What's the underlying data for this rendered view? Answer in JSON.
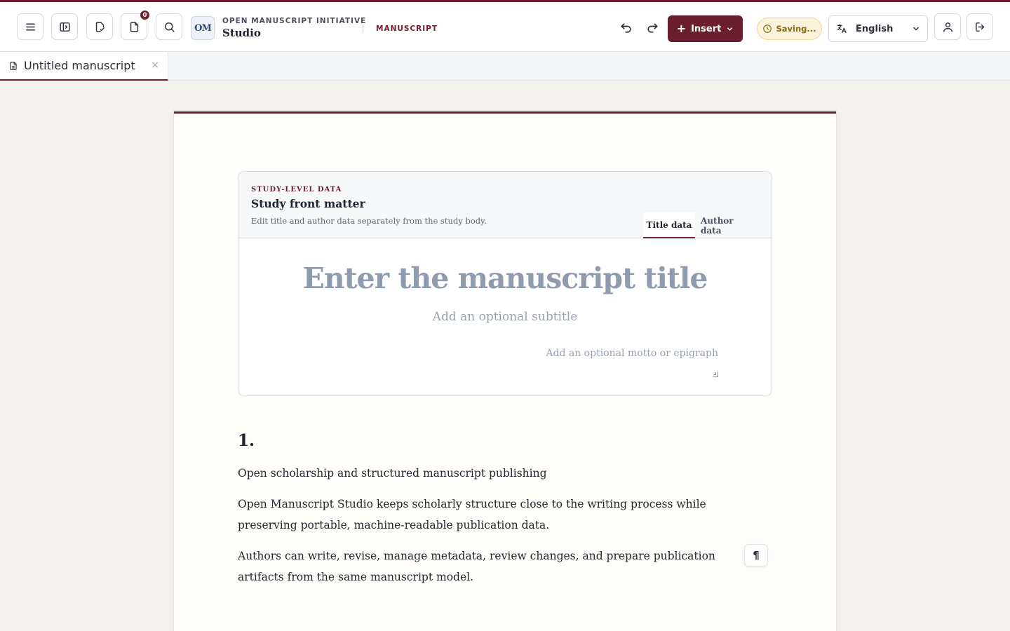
{
  "header": {
    "org_name": "OPEN MANUSCRIPT INITIATIVE",
    "app_name": "Studio",
    "logo_text": "OM",
    "mode": "MANUSCRIPT",
    "notification_count": "0",
    "insert_label": "Insert",
    "status": "Saving...",
    "language": "English"
  },
  "tabs": [
    {
      "label": "Untitled manuscript",
      "close": "×"
    }
  ],
  "front_matter": {
    "eyebrow": "STUDY-LEVEL DATA",
    "title": "Study front matter",
    "description": "Edit title and author data separately from the study body.",
    "tab_title": "Title data",
    "tab_author": "Author data",
    "title_placeholder": "Enter the manuscript title",
    "subtitle_placeholder": "Add an optional subtitle",
    "motto_placeholder": "Add an optional motto or epigraph"
  },
  "body": {
    "section_number": "1.",
    "paragraphs": [
      "Open scholarship and structured manuscript publishing",
      "Open Manuscript Studio keeps scholarly structure close to the writing process while preserving portable, machine-readable publication data.",
      "Authors can write, revise, manage metadata, review changes, and prepare publication artifacts from the same manuscript model."
    ],
    "pilcrow": "¶"
  },
  "colors": {
    "accent": "#6b1f2e",
    "status_bg": "#fbf3dc",
    "placeholder": "#8f9cb0"
  },
  "icons": [
    "menu-icon",
    "sidebar-toggle-icon",
    "document-check-icon",
    "document-icon",
    "search-icon",
    "undo-icon",
    "redo-icon",
    "clock-icon",
    "translate-icon",
    "chevron-down-icon",
    "user-icon",
    "logout-icon",
    "file-text-icon",
    "close-icon"
  ]
}
